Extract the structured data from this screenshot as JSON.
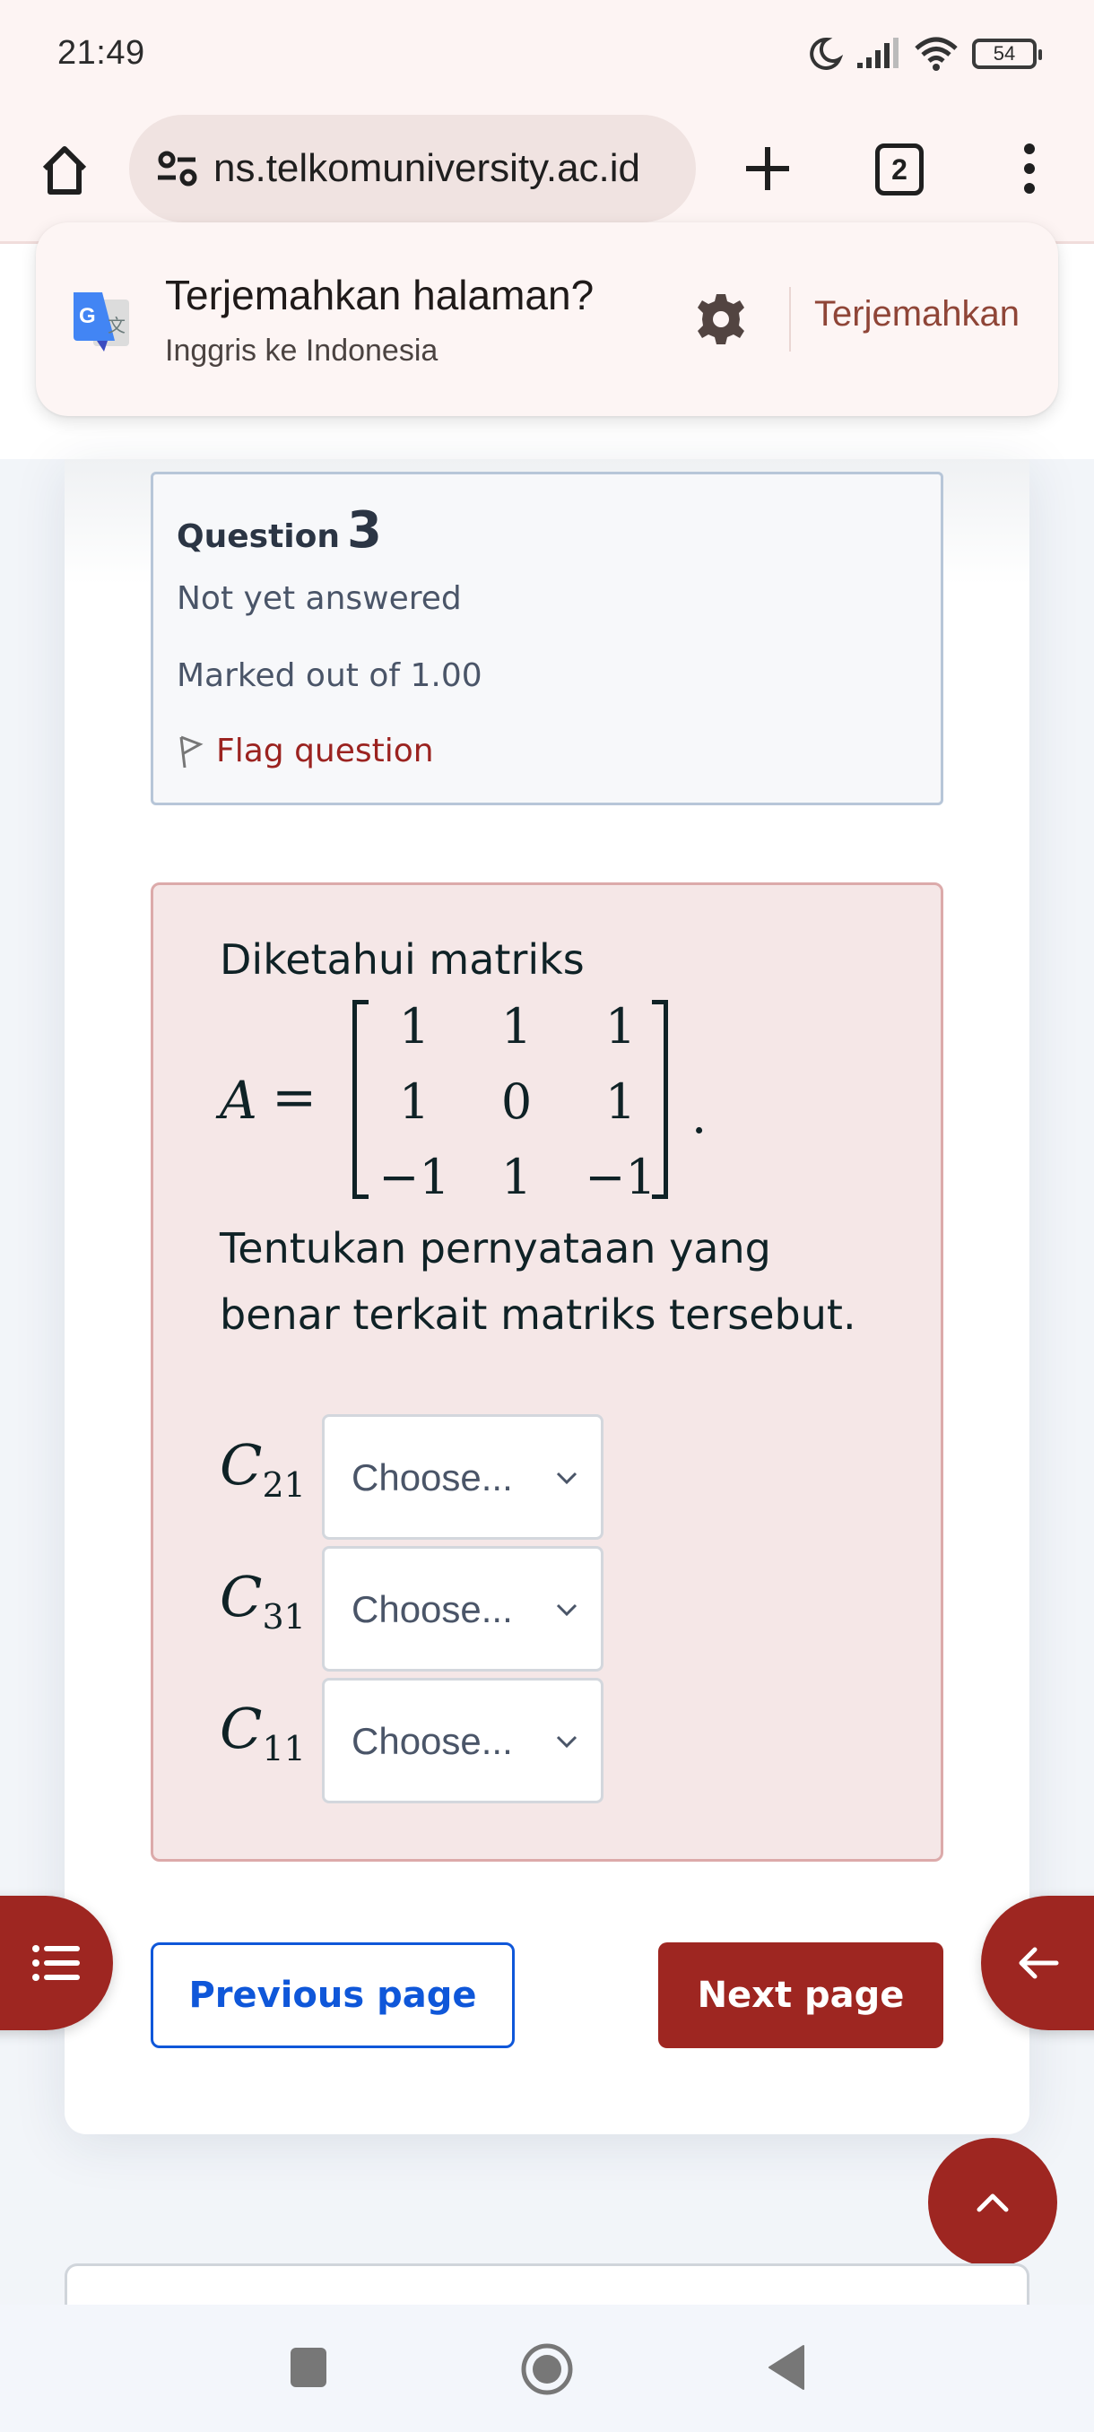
{
  "status_bar": {
    "time": "21:49",
    "icons": [
      "moon-icon",
      "signal-icon",
      "wifi-icon"
    ],
    "battery": "54"
  },
  "browser": {
    "url": "ns.telkomuniversity.ac.id",
    "tab_count": "2",
    "icons": {
      "home": "home-icon",
      "site_info": "tune-icon",
      "new_tab": "plus-icon",
      "menu": "more-vert-icon"
    }
  },
  "translate": {
    "title": "Terjemahkan halaman?",
    "subtitle": "Inggris ke Indonesia",
    "action": "Terjemahkan"
  },
  "question": {
    "word": "Question",
    "number": "3",
    "status": "Not yet answered",
    "marks": "Marked out of 1.00",
    "flag_label": "Flag question"
  },
  "content": {
    "intro": "Diketahui matriks",
    "matrix_name": "A",
    "equals": "=",
    "matrix": [
      [
        "1",
        "1",
        "1"
      ],
      [
        "1",
        "0",
        "1"
      ],
      [
        "−1",
        "1",
        "−1"
      ]
    ],
    "period": ".",
    "instruction_line1": "Tentukan pernyataan yang",
    "instruction_line2": "benar terkait matriks tersebut.",
    "choices": [
      {
        "symbol": "C",
        "subscript": "21",
        "value": "Choose..."
      },
      {
        "symbol": "C",
        "subscript": "31",
        "value": "Choose..."
      },
      {
        "symbol": "C",
        "subscript": "11",
        "value": "Choose..."
      }
    ]
  },
  "navigation": {
    "previous": "Previous page",
    "next": "Next page"
  },
  "colors": {
    "brand_red": "#9e2621",
    "link_blue": "#0f57d9",
    "content_bg": "#f5e7e7"
  }
}
